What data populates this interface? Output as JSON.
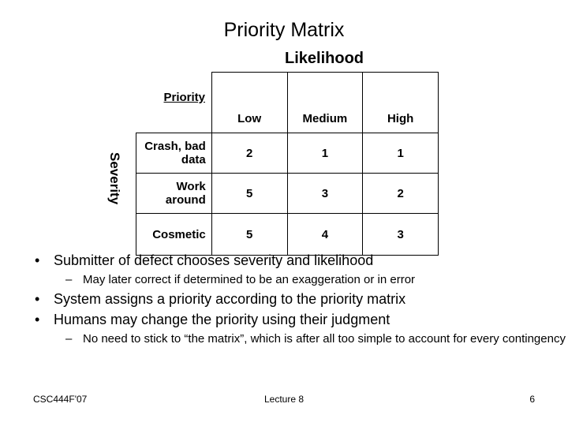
{
  "slide": {
    "title": "Priority Matrix"
  },
  "matrix": {
    "col_axis_label": "Likelihood",
    "row_axis_label": "Severity",
    "corner_label": "Priority",
    "columns": [
      "Low",
      "Medium",
      "High"
    ],
    "rows": [
      {
        "label": "Crash, bad data",
        "values": [
          "2",
          "1",
          "1"
        ]
      },
      {
        "label": "Work around",
        "values": [
          "5",
          "3",
          "2"
        ]
      },
      {
        "label": "Cosmetic",
        "values": [
          "5",
          "4",
          "3"
        ]
      }
    ]
  },
  "bullets": {
    "b1": "Submitter of defect chooses severity and likelihood",
    "b1_mark": "•",
    "b1_sub": "May later correct if determined to be an exaggeration or in error",
    "b1_sub_mark": "–",
    "b2": "System assigns a priority according to the priority matrix",
    "b2_mark": "•",
    "b3": "Humans may change the priority using their judgment",
    "b3_mark": "•",
    "b3_sub": "No need to stick to “the matrix”, which is after all too simple to account for every contingency",
    "b3_sub_mark": "–"
  },
  "footer": {
    "left": "CSC444F'07",
    "center": "Lecture 8",
    "right": "6"
  }
}
